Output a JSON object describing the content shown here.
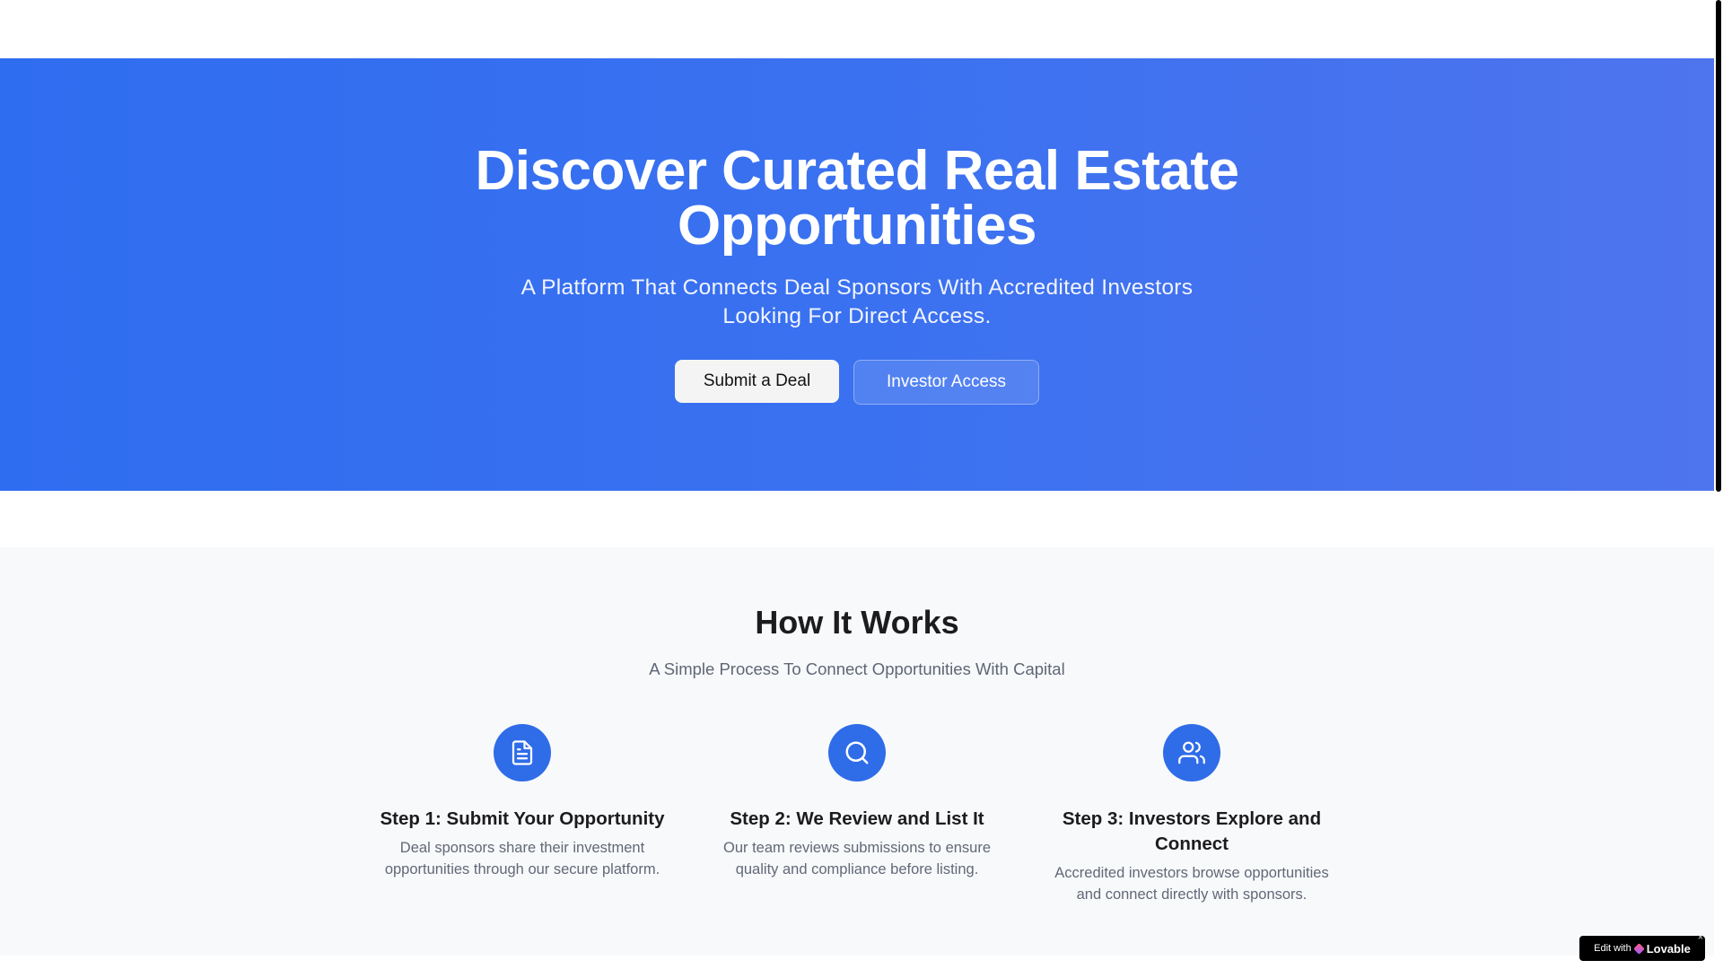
{
  "hero": {
    "title": "Discover Curated Real Estate Opportunities",
    "subtitle": "A Platform That Connects Deal Sponsors With Accredited Investors Looking For Direct Access.",
    "primary_button": "Submit a Deal",
    "secondary_button": "Investor Access"
  },
  "how_it_works": {
    "title": "How It Works",
    "subtitle": "A Simple Process To Connect Opportunities With Capital",
    "steps": [
      {
        "icon": "document-icon",
        "title": "Step 1: Submit Your Opportunity",
        "description": "Deal sponsors share their investment opportunities through our secure platform."
      },
      {
        "icon": "search-icon",
        "title": "Step 2: We Review and List It",
        "description": "Our team reviews submissions to ensure quality and compliance before listing."
      },
      {
        "icon": "users-icon",
        "title": "Step 3: Investors Explore and Connect",
        "description": "Accredited investors browse opportunities and connect directly with sponsors."
      }
    ]
  },
  "badge": {
    "prefix": "Edit with",
    "brand": "Lovable",
    "close": "×"
  },
  "colors": {
    "hero_gradient_start": "#2f6df0",
    "hero_gradient_end": "#4e74ee",
    "step_icon_bg": "#2f6ce8",
    "section_bg": "#f8f9fb"
  }
}
